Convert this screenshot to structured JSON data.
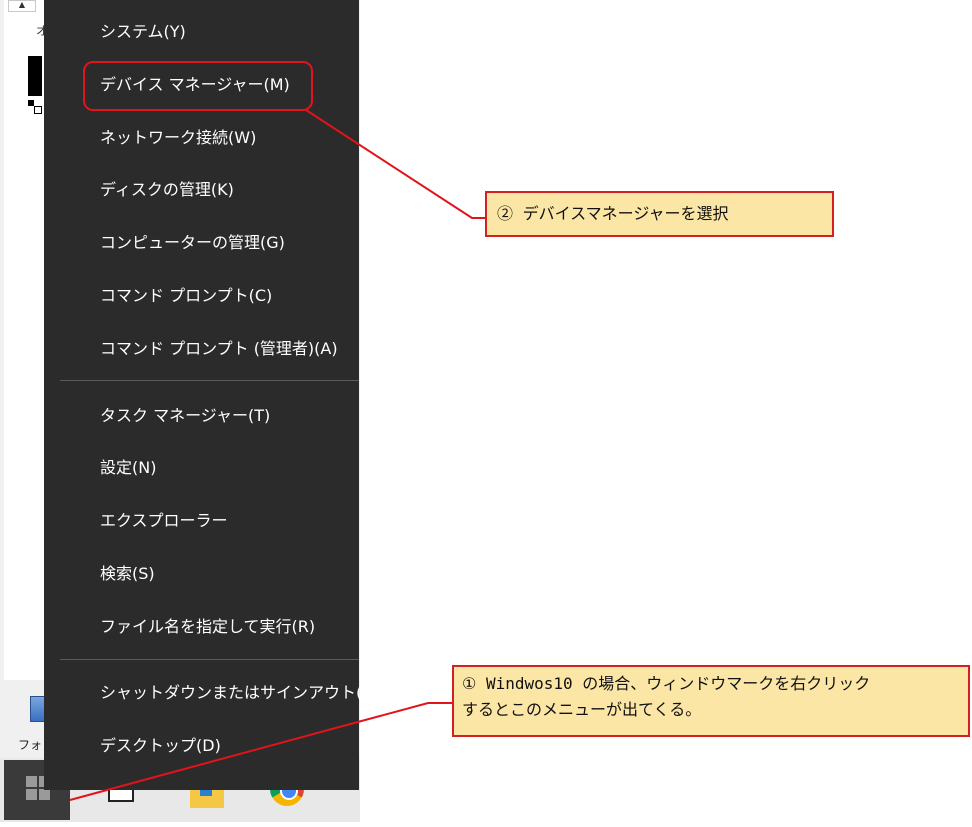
{
  "desktop": {
    "partial_label_top": "オ",
    "desktop_icon_label": "フォ"
  },
  "menu": {
    "items": [
      "システム(Y)",
      "デバイス マネージャー(M)",
      "ネットワーク接続(W)",
      "ディスクの管理(K)",
      "コンピューターの管理(G)",
      "コマンド プロンプト(C)",
      "コマンド プロンプト (管理者)(A)",
      "タスク マネージャー(T)",
      "設定(N)",
      "エクスプローラー",
      "検索(S)",
      "ファイル名を指定して実行(R)",
      "シャットダウンまたはサインアウト(U)",
      "デスクトップ(D)"
    ]
  },
  "callouts": {
    "step2": "② デバイスマネージャーを選択",
    "step1_line1": "① Windwos10 の場合、ウィンドウマークを右クリック",
    "step1_line2": "するとこのメニューが出てくる。"
  },
  "colors": {
    "menu_bg": "#2b2b2b",
    "menu_text": "#ffffff",
    "annotation_red": "#e0141a",
    "callout_bg": "#fbe6a6"
  },
  "icons": {
    "start": "windows-logo-icon",
    "taskview": "task-view-icon",
    "explorer": "file-explorer-icon",
    "chrome": "chrome-icon"
  }
}
